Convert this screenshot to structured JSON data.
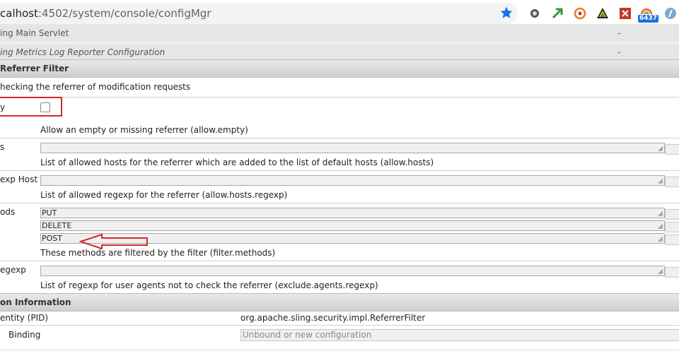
{
  "browser": {
    "url_prefix": "calhost",
    "url_rest": ":4502/system/console/configMgr",
    "extension_badge": "6437",
    "icons": [
      "bookmark-star-icon",
      "extension-gray-icon",
      "extension-green-icon",
      "extension-orange-icon",
      "extension-drive-icon",
      "extension-red-icon",
      "extension-rainbow-icon",
      "extension-blue-icon"
    ]
  },
  "config_list": [
    {
      "label": "ing Main Servlet",
      "value": "-"
    },
    {
      "label": "ing Metrics Log Reporter Configuration",
      "value": "-"
    }
  ],
  "filter": {
    "title": "Referrer Filter",
    "description": "hecking the referrer of modification requests",
    "fields": {
      "allow_empty": {
        "label": "y",
        "help": "Allow an empty or missing referrer (allow.empty)"
      },
      "allow_hosts": {
        "label": "s",
        "value": "",
        "help": "List of allowed hosts for the referrer which are added to the list of default hosts (allow.hosts)"
      },
      "allow_hosts_regexp": {
        "label": "exp Host",
        "value": "",
        "help": "List of allowed regexp for the referrer (allow.hosts.regexp)"
      },
      "filter_methods": {
        "label": "ods",
        "values": [
          "PUT",
          "DELETE",
          "POST"
        ],
        "help": "These methods are filtered by the filter (filter.methods)"
      },
      "exclude_agents": {
        "label": "egexp",
        "value": "",
        "help": "List of regexp for user agents not to check the referrer (exclude.agents.regexp)"
      }
    }
  },
  "info": {
    "title": "on Information",
    "pid_label": "entity (PID)",
    "pid_value": "org.apache.sling.security.impl.ReferrerFilter",
    "binding_label": "Binding",
    "binding_value": "Unbound or new configuration"
  },
  "colors": {
    "highlight_red": "#d42a2a",
    "accent_blue": "#1a73e8"
  }
}
